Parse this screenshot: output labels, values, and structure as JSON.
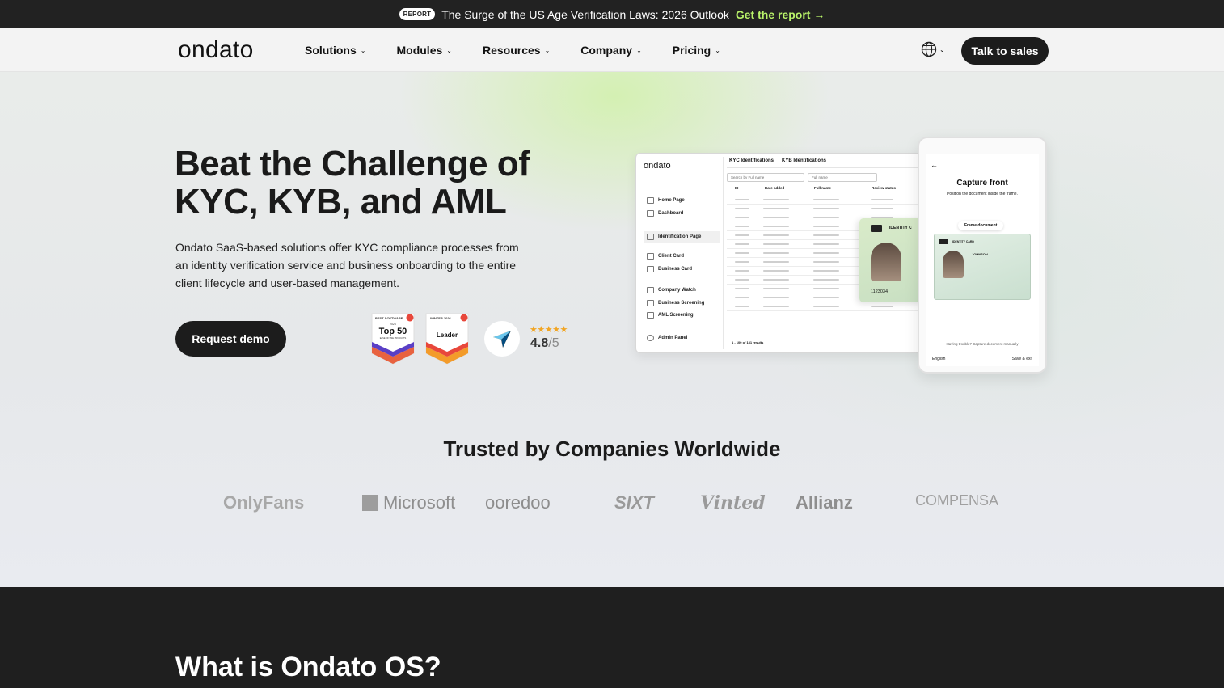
{
  "announcement": {
    "pill": "REPORT",
    "text": "The Surge of the US Age Verification Laws: 2026 Outlook",
    "cta": "Get the report →"
  },
  "nav": {
    "logo": "ondato",
    "items": [
      {
        "label": "Solutions"
      },
      {
        "label": "Modules"
      },
      {
        "label": "Resources"
      },
      {
        "label": "Company"
      },
      {
        "label": "Pricing"
      }
    ],
    "cta": "Talk to sales"
  },
  "hero": {
    "title": "Beat the Challenge of KYC, KYB, and AML",
    "description": "Ondato SaaS-based solutions offer KYC compliance processes from an identity verification service and business onboarding to the entire client lifecycle and user-based management.",
    "button": "Request demo",
    "badges": [
      {
        "top": "BEST SOFTWARE",
        "year": "2026",
        "main": "Top 50",
        "sub": "EASE OF USE PRODUCTS"
      },
      {
        "top": "WINTER 2026",
        "year": "",
        "main": "Leader",
        "sub": ""
      }
    ],
    "rating": {
      "stars": "★★★★★",
      "value": "4.8",
      "outOf": "/5"
    }
  },
  "dashboard": {
    "logo": "ondato",
    "tabs": [
      "KYC Identifications",
      "KYB Identifications"
    ],
    "search_placeholder": "Search by Full name",
    "filter": "Full name",
    "columns": [
      "ID",
      "Date added",
      "Full name",
      "Review status"
    ],
    "sidebar": [
      "Home Page",
      "Dashboard",
      "Identification Page",
      "Client Card",
      "Business Card",
      "Company Watch",
      "Business Screening",
      "AML Screening",
      "Admin Panel"
    ],
    "footer": "1 - 100 of 131 results",
    "card_label": "IDENTITY C",
    "card_number": "1123034"
  },
  "phone": {
    "title": "Capture front",
    "subtitle": "Position the document inside the frame.",
    "frame_tag": "Frame document",
    "card_label": "IDENTITY CARD",
    "card_name": "JOHNSON",
    "help": "Having trouble? Capture document manually",
    "language": "English",
    "save": "Save & exit"
  },
  "trusted": {
    "title": "Trusted by Companies Worldwide",
    "logos": [
      "OnlyFans",
      "Microsoft",
      "ooredoo",
      "SIXT",
      "Vinted",
      "Allianz",
      "COMPENSA"
    ]
  },
  "next_section": {
    "title": "What is Ondato OS?"
  }
}
